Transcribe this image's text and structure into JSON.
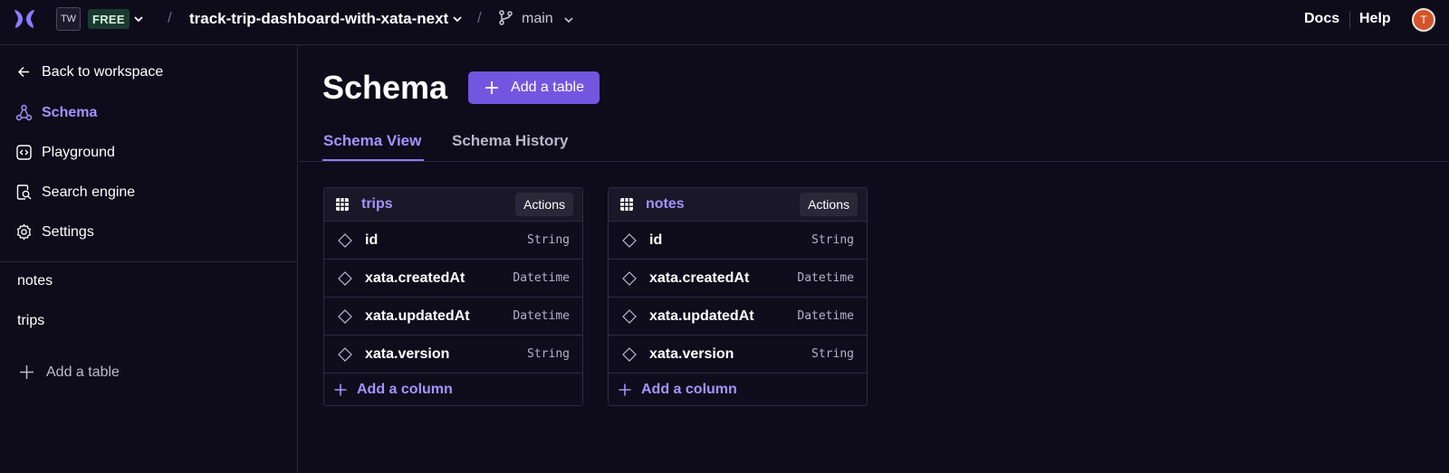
{
  "topbar": {
    "workspace_initials": "TW",
    "plan_badge": "FREE",
    "separator": "/",
    "database_name": "track-trip-dashboard-with-xata-next",
    "branch_name": "main",
    "docs_label": "Docs",
    "help_label": "Help",
    "avatar_initial": "T"
  },
  "sidebar": {
    "back_label": "Back to workspace",
    "items": [
      {
        "label": "Schema",
        "icon": "schema-icon",
        "active": true
      },
      {
        "label": "Playground",
        "icon": "code-icon",
        "active": false
      },
      {
        "label": "Search engine",
        "icon": "search-engine-icon",
        "active": false
      },
      {
        "label": "Settings",
        "icon": "gear-icon",
        "active": false
      }
    ],
    "tables": [
      "notes",
      "trips"
    ],
    "add_table_label": "Add a table"
  },
  "main": {
    "title": "Schema",
    "add_table_button": "Add a table",
    "tabs": [
      {
        "label": "Schema View",
        "active": true
      },
      {
        "label": "Schema History",
        "active": false
      }
    ],
    "tables": [
      {
        "name": "trips",
        "actions_label": "Actions",
        "columns": [
          {
            "name": "id",
            "type": "String"
          },
          {
            "name": "xata.createdAt",
            "type": "Datetime"
          },
          {
            "name": "xata.updatedAt",
            "type": "Datetime"
          },
          {
            "name": "xata.version",
            "type": "String"
          }
        ],
        "add_column_label": "Add a column"
      },
      {
        "name": "notes",
        "actions_label": "Actions",
        "columns": [
          {
            "name": "id",
            "type": "String"
          },
          {
            "name": "xata.createdAt",
            "type": "Datetime"
          },
          {
            "name": "xata.updatedAt",
            "type": "Datetime"
          },
          {
            "name": "xata.version",
            "type": "String"
          }
        ],
        "add_column_label": "Add a column"
      }
    ]
  },
  "colors": {
    "background": "#0e0c1a",
    "accent": "#a593ff",
    "button": "#7356e0",
    "plan_badge_bg": "#1b3a2f",
    "avatar": "#d3542a"
  }
}
